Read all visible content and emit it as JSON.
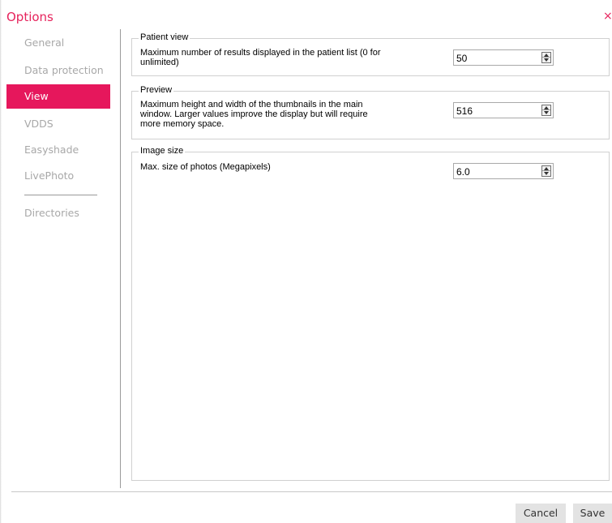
{
  "window": {
    "title": "Options",
    "close_glyph": "×"
  },
  "sidebar": {
    "items": [
      {
        "label": "General"
      },
      {
        "label": "Data protection"
      },
      {
        "label": "View",
        "active": true
      },
      {
        "label": "VDDS"
      },
      {
        "label": "Easyshade"
      },
      {
        "label": "LivePhoto"
      },
      {
        "label": "Directories"
      }
    ]
  },
  "groups": {
    "patient_view": {
      "title": "Patient view",
      "desc": [
        "Maximum number of results displayed in the patient list (0 for",
        "unlimited)"
      ],
      "value": "50"
    },
    "preview": {
      "title": "Preview",
      "desc": [
        "Maximum height and width of the thumbnails in the main",
        "window. Larger values improve the display but will require",
        "more memory space."
      ],
      "value": "516"
    },
    "image_size": {
      "title": "Image size",
      "desc": [
        "Max. size of photos (Megapixels)"
      ],
      "value": "6.0"
    }
  },
  "footer": {
    "cancel_label": "Cancel",
    "save_label": "Save"
  },
  "colors": {
    "accent": "#e6175c",
    "text_muted": "#a8a8a8"
  }
}
